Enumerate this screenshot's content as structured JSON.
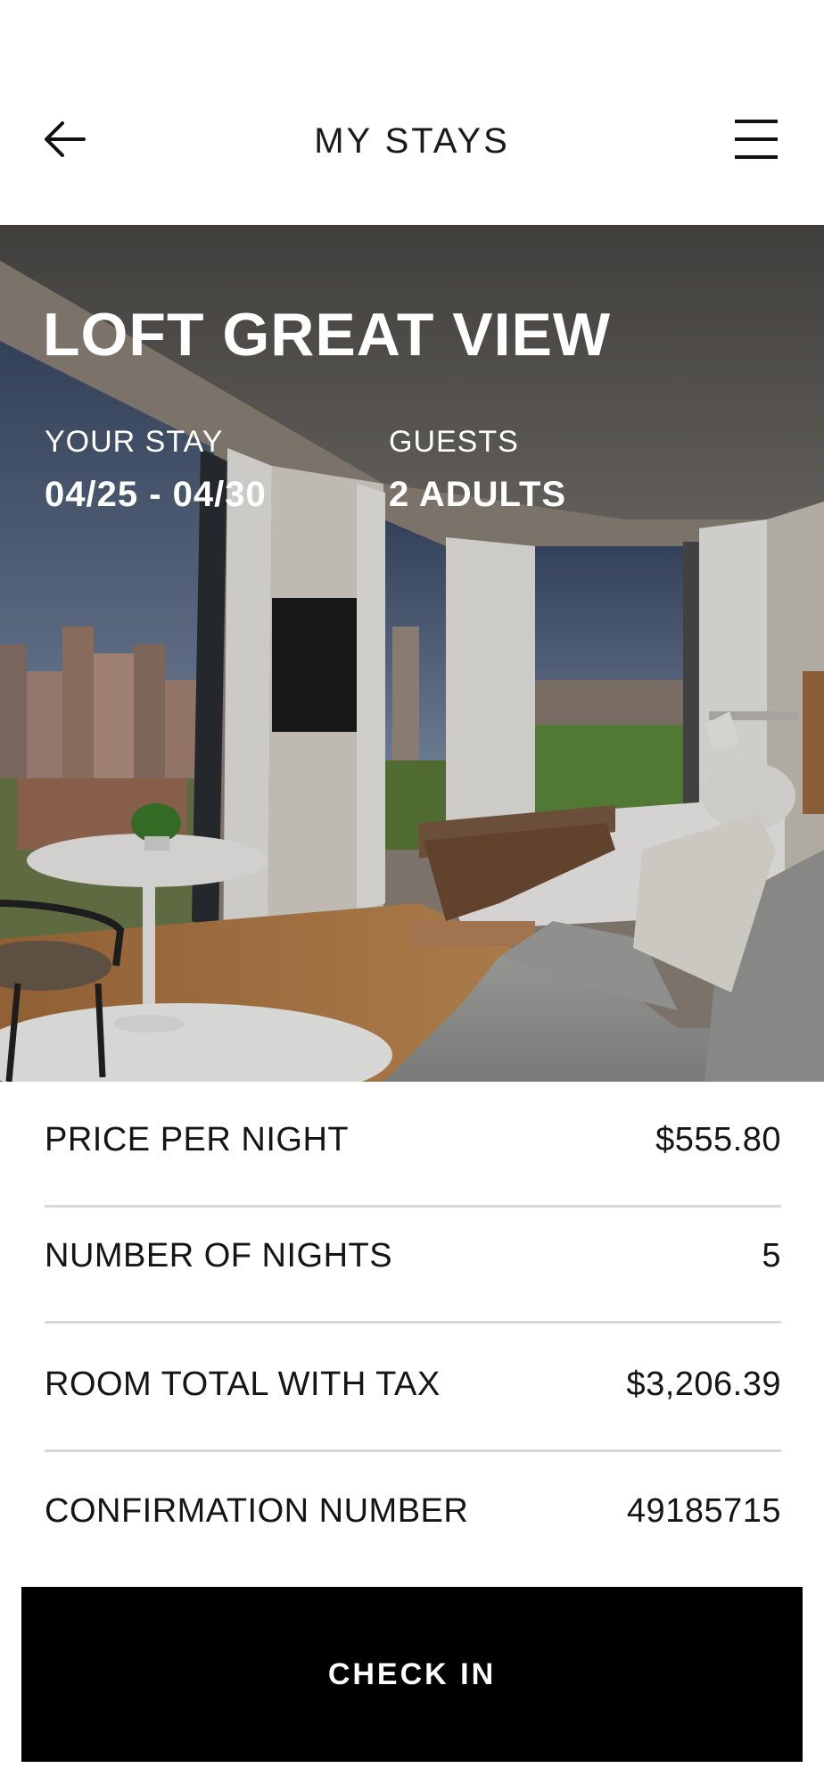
{
  "header": {
    "title": "MY STAYS",
    "back_icon": "arrow-left-icon",
    "menu_icon": "hamburger-menu-icon"
  },
  "hero": {
    "room_name": "LOFT GREAT VIEW",
    "stay_label": "YOUR STAY",
    "stay_dates": "04/25 - 04/30",
    "guests_label": "GUESTS",
    "guests_value": "2 ADULTS"
  },
  "details": [
    {
      "label": "PRICE PER NIGHT",
      "value": "$555.80"
    },
    {
      "label": "NUMBER OF NIGHTS",
      "value": "5"
    },
    {
      "label": "ROOM TOTAL WITH TAX",
      "value": "$3,206.39"
    },
    {
      "label": "CONFIRMATION NUMBER",
      "value": "49185715"
    }
  ],
  "actions": {
    "check_in_label": "CHECK IN"
  },
  "colors": {
    "primary_button": "#000000",
    "divider": "#d9d9d9",
    "text": "#151515"
  }
}
